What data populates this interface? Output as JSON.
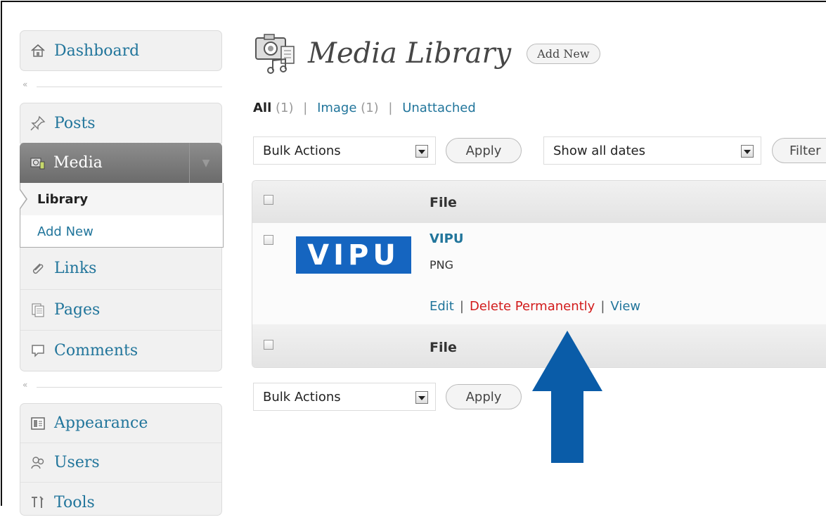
{
  "sidebar": {
    "dashboard": "Dashboard",
    "posts": "Posts",
    "media": "Media",
    "library": "Library",
    "add_new": "Add New",
    "links": "Links",
    "pages": "Pages",
    "comments": "Comments",
    "appearance": "Appearance",
    "users": "Users",
    "tools": "Tools",
    "collapse_glyph": "«",
    "toggle_glyph": "▼"
  },
  "header": {
    "title": "Media Library",
    "add_new": "Add New"
  },
  "filters": {
    "all": "All",
    "all_count": "(1)",
    "image": "Image",
    "image_count": "(1)",
    "unattached": "Unattached",
    "separator": "|"
  },
  "toolbar": {
    "bulk_actions": "Bulk Actions",
    "apply": "Apply",
    "show_all_dates": "Show all dates",
    "filter": "Filter"
  },
  "table": {
    "column_file": "File",
    "rows": [
      {
        "thumbnail_text": "VIPU",
        "name": "VIPU",
        "type": "PNG",
        "actions": {
          "edit": "Edit",
          "delete": "Delete Permanently",
          "view": "View"
        }
      }
    ]
  },
  "colors": {
    "link": "#21759b",
    "delete": "#d21b1b",
    "thumbnail": "#1565c0",
    "arrow": "#0a5ca8"
  },
  "icons": [
    "home-icon",
    "pushpin-icon",
    "media-icon",
    "paperclip-icon",
    "pages-icon",
    "comment-icon",
    "appearance-icon",
    "users-icon",
    "tools-icon",
    "camera-music-icon",
    "up-arrow-icon"
  ]
}
